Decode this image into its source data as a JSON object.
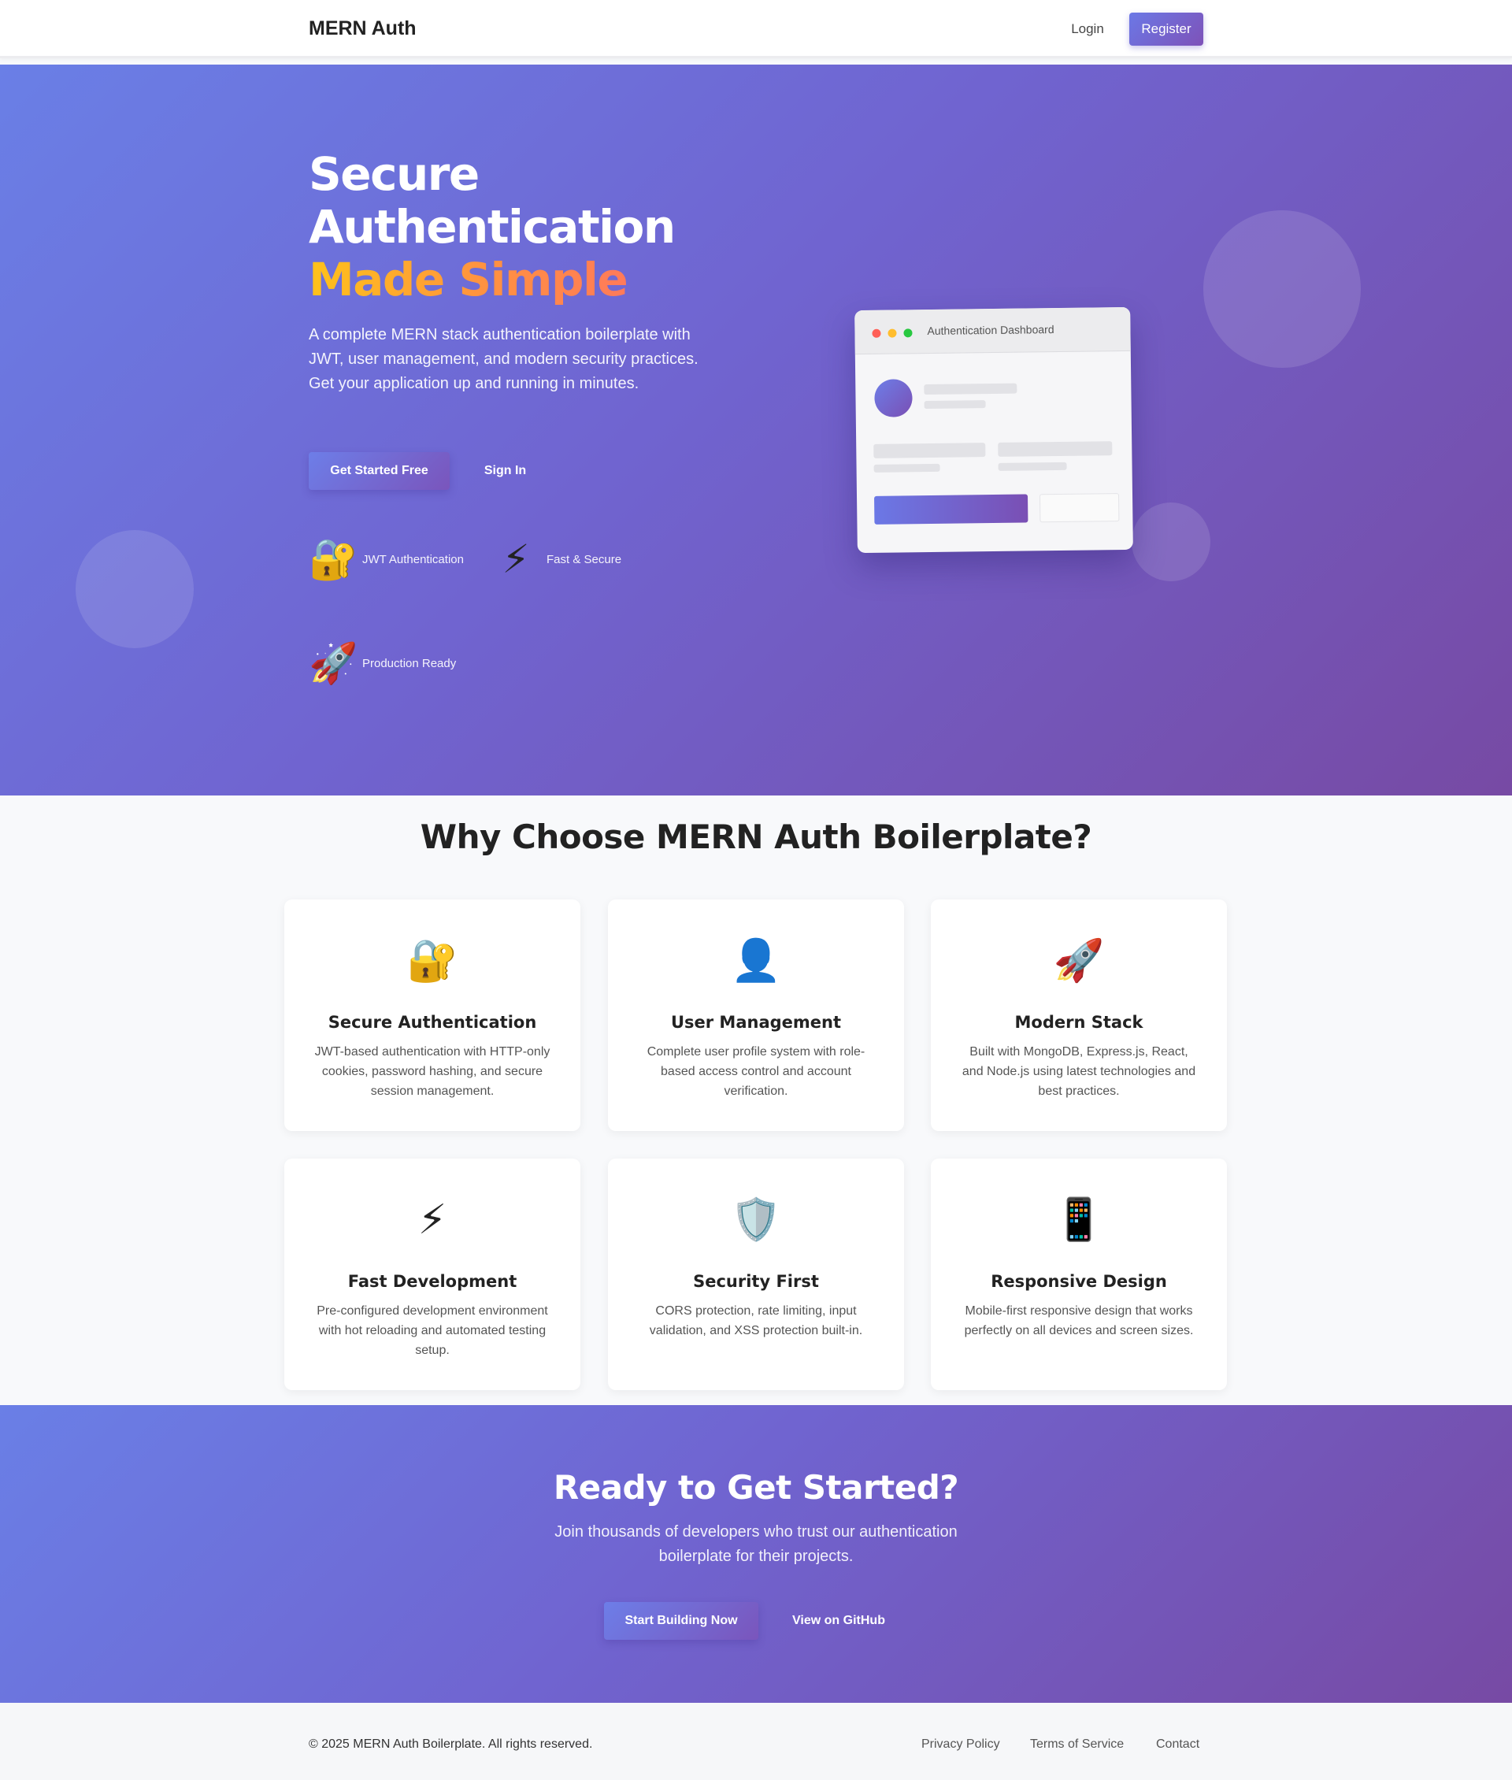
{
  "navbar": {
    "brand": "MERN Auth",
    "login": "Login",
    "register": "Register"
  },
  "hero": {
    "title_line1": "Secure",
    "title_line2": "Authentication",
    "title_accent": "Made Simple",
    "description": "A complete MERN stack authentication boilerplate with JWT, user management, and modern security practices. Get your application up and running in minutes.",
    "primary_button": "Get Started Free",
    "secondary_button": "Sign In",
    "features": [
      {
        "icon": "🔐",
        "icon_name": "lock-key-icon",
        "label": "JWT Authentication"
      },
      {
        "icon": "⚡",
        "icon_name": "lightning-icon",
        "label": "Fast & Secure"
      },
      {
        "icon": "🚀",
        "icon_name": "rocket-icon",
        "label": "Production Ready"
      }
    ],
    "dashboard": {
      "title": "Authentication Dashboard",
      "dot_colors": [
        "#ff5f57",
        "#ffbd2e",
        "#28c840"
      ]
    }
  },
  "why": {
    "title": "Why Choose MERN Auth Boilerplate?",
    "cards": [
      {
        "icon": "🔐",
        "icon_name": "lock-key-icon",
        "title": "Secure Authentication",
        "description": "JWT-based authentication with HTTP-only cookies, password hashing, and secure session management."
      },
      {
        "icon": "👤",
        "icon_name": "user-icon",
        "title": "User Management",
        "description": "Complete user profile system with role-based access control and account verification."
      },
      {
        "icon": "🚀",
        "icon_name": "rocket-icon",
        "title": "Modern Stack",
        "description": "Built with MongoDB, Express.js, React, and Node.js using latest technologies and best practices."
      },
      {
        "icon": "⚡",
        "icon_name": "lightning-icon",
        "title": "Fast Development",
        "description": "Pre-configured development environment with hot reloading and automated testing setup."
      },
      {
        "icon": "🛡️",
        "icon_name": "shield-icon",
        "title": "Security First",
        "description": "CORS protection, rate limiting, input validation, and XSS protection built-in."
      },
      {
        "icon": "📱",
        "icon_name": "mobile-phone-icon",
        "title": "Responsive Design",
        "description": "Mobile-first responsive design that works perfectly on all devices and screen sizes."
      }
    ]
  },
  "cta": {
    "title": "Ready to Get Started?",
    "description": "Join thousands of developers who trust our authentication boilerplate for their projects.",
    "primary_button": "Start Building Now",
    "secondary_button": "View on GitHub"
  },
  "footer": {
    "copyright": "© 2025 MERN Auth Boilerplate. All rights reserved.",
    "links": [
      "Privacy Policy",
      "Terms of Service",
      "Contact"
    ]
  },
  "colors": {
    "brand_gradient_start": "#6a7fe6",
    "brand_gradient_end": "#774aa4",
    "accent_gradient_start": "#ffc21a",
    "accent_gradient_end": "#ff7a5a"
  }
}
